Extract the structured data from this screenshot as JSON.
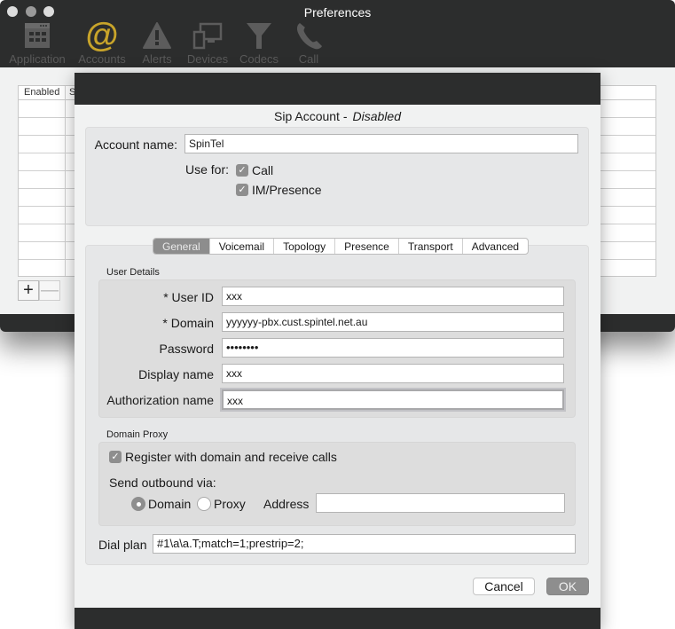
{
  "window": {
    "title": "Preferences",
    "toolbar": [
      {
        "id": "application",
        "label": "Application",
        "icon": "calendar-grid-icon"
      },
      {
        "id": "accounts",
        "label": "Accounts",
        "icon": "at-sign-icon",
        "active": true
      },
      {
        "id": "alerts",
        "label": "Alerts",
        "icon": "warning-triangle-icon"
      },
      {
        "id": "devices",
        "label": "Devices",
        "icon": "devices-icon"
      },
      {
        "id": "codecs",
        "label": "Codecs",
        "icon": "funnel-icon"
      },
      {
        "id": "call",
        "label": "Call",
        "icon": "phone-icon"
      }
    ],
    "accent_color": "#c8a42a"
  },
  "accounts_table": {
    "columns": [
      "Enabled",
      "S"
    ],
    "rows": 10,
    "add_label": "+",
    "remove_label": "—"
  },
  "sheet": {
    "title": "Sip Account -",
    "status": "Disabled",
    "account_name_label": "Account name:",
    "account_name_value": "SpinTel",
    "use_for_label": "Use for:",
    "use_for": [
      {
        "label": "Call",
        "checked": true
      },
      {
        "label": "IM/Presence",
        "checked": true
      }
    ],
    "tabs": [
      {
        "label": "General",
        "active": true
      },
      {
        "label": "Voicemail"
      },
      {
        "label": "Topology"
      },
      {
        "label": "Presence"
      },
      {
        "label": "Transport"
      },
      {
        "label": "Advanced"
      }
    ],
    "user_details": {
      "heading": "User Details",
      "fields": [
        {
          "label": "* User ID",
          "value": "xxx"
        },
        {
          "label": "* Domain",
          "value": "yyyyyy-pbx.cust.spintel.net.au"
        },
        {
          "label": "Password",
          "value": "••••••••"
        },
        {
          "label": "Display name",
          "value": "xxx"
        },
        {
          "label": "Authorization name",
          "value": "xxx",
          "focused": true
        }
      ]
    },
    "domain_proxy": {
      "heading": "Domain Proxy",
      "register_label": "Register with domain and receive calls",
      "register_checked": true,
      "send_outbound_label": "Send outbound via:",
      "options": [
        {
          "label": "Domain",
          "selected": true
        },
        {
          "label": "Proxy",
          "selected": false
        }
      ],
      "address_label": "Address",
      "address_value": ""
    },
    "dial_plan_label": "Dial plan",
    "dial_plan_value": "#1\\a\\a.T;match=1;prestrip=2;",
    "cancel_label": "Cancel",
    "ok_label": "OK"
  }
}
